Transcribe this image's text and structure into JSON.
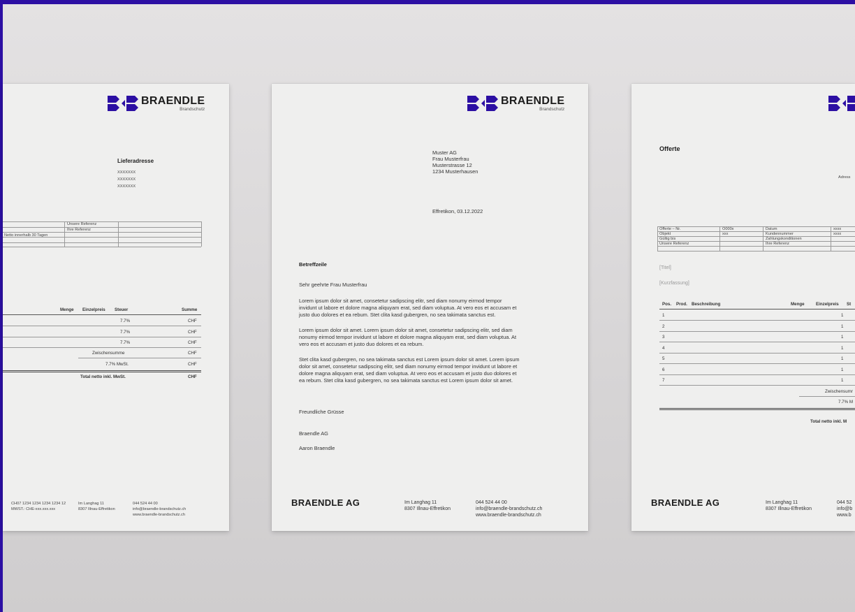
{
  "brand": {
    "name": "BRAENDLE",
    "sub": "Brandschutz",
    "footer_name": "BRAENDLE AG",
    "accent": "#2c0fa3"
  },
  "contact": {
    "address1": "Im Langhag 11",
    "address2": "8307 Illnau-Effretikon",
    "phone": "044 524 44 00",
    "email": "info@braendle-brandschutz.ch",
    "web": "www.braendle-brandschutz.ch"
  },
  "invoice": {
    "lieferadresse_title": "Lieferadresse",
    "address_lines": [
      "XXXXXXX",
      "XXXXXXX",
      "XXXXXXX"
    ],
    "ref_table": {
      "unsere_referenz": "Unsere Referenz",
      "ihre_referenz": "Ihre Referenz",
      "netto": "Netto innerhalb 30 Tagen"
    },
    "items_header": {
      "menge": "Menge",
      "einzelpreis": "Einzelpreis",
      "steuer": "Steuer",
      "summe": "Summe"
    },
    "rows": [
      {
        "steuer": "7.7%",
        "summe": "CHF"
      },
      {
        "steuer": "7.7%",
        "summe": "CHF"
      },
      {
        "steuer": "7.7%",
        "summe": "CHF"
      }
    ],
    "zwischensumme": "Zwischensumme",
    "zwischensumme_value": "CHF",
    "mwst": "7.7% MwSt.",
    "mwst_value": "CHF",
    "total": "Total netto inkl. MwSt.",
    "total_value": "CHF",
    "footer_iban": "CH07 1234 1234 1234 1234 12",
    "footer_mwst": "MWST.: CHE-xxx.xxx.xxx"
  },
  "letter": {
    "recipient": [
      "Muster AG",
      "Frau Musterfrau",
      "Musterstrasse 12",
      "1234 Musterhausen"
    ],
    "date": "Effretikon, 03.12.2022",
    "subject": "Betreffzeile",
    "salutation": "Sehr geehrte Frau Musterfrau",
    "paragraphs": [
      [
        "Lorem ipsum dolor sit amet, consetetur sadipscing elitr, sed diam nonumy eirmod tempor",
        "invidunt ut labore et dolore magna aliquyam erat, sed diam voluptua. At vero eos et accusam et",
        "justo duo dolores et ea rebum. Stet clita kasd gubergren, no sea takimata sanctus est."
      ],
      [
        "Lorem ipsum dolor sit amet. Lorem ipsum dolor sit amet, consetetur sadipscing elitr, sed diam",
        "nonumy eirmod tempor invidunt ut labore et dolore magna aliquyam erat, sed diam voluptua. At",
        "vero eos et accusam et justo duo dolores et ea rebum."
      ],
      [
        "Stet clita kasd gubergren, no sea takimata sanctus est Lorem ipsum dolor sit amet. Lorem ipsum",
        "dolor sit amet, consetetur sadipscing elitr, sed diam nonumy eirmod tempor invidunt ut labore et",
        "dolore magna aliquyam erat, sed diam voluptua. At vero eos et accusam et justo duo dolores et",
        "ea rebum. Stet clita kasd gubergren, no sea takimata sanctus est Lorem ipsum dolor sit amet."
      ]
    ],
    "closing": "Freundliche Grüsse",
    "company": "Braendle AG",
    "signer": "Aaron Braendle"
  },
  "offer": {
    "title": "Offerte",
    "adresse_label": "Adress",
    "fields_left": [
      {
        "label": "Offerte – Nr.",
        "value": "O000x"
      },
      {
        "label": "Objekt",
        "value": "xxx"
      },
      {
        "label": "Gültig bis",
        "value": ""
      },
      {
        "label": "Unsere Referenz",
        "value": ""
      }
    ],
    "fields_right": [
      {
        "label": "Datum",
        "value": "xxxx"
      },
      {
        "label": "Kundennummer",
        "value": "xxxx"
      },
      {
        "label": "Zahlungskonditionen",
        "value": ""
      },
      {
        "label": "Ihre Referenz",
        "value": ""
      }
    ],
    "titel_placeholder": "[Titel]",
    "kurz_placeholder": "[Kurzfassung]",
    "table_header": {
      "pos": "Pos.",
      "prod": "Prod.",
      "beschreibung": "Beschreibung",
      "menge": "Menge",
      "einzelpreis": "Einzelpreis",
      "st": "St"
    },
    "rows": [
      {
        "pos": "1",
        "menge": "1"
      },
      {
        "pos": "2",
        "menge": "1"
      },
      {
        "pos": "3",
        "menge": "1"
      },
      {
        "pos": "4",
        "menge": "1"
      },
      {
        "pos": "5",
        "menge": "1"
      },
      {
        "pos": "6",
        "menge": "1"
      },
      {
        "pos": "7",
        "menge": "1"
      }
    ],
    "zwischensumme": "Zwischensumr",
    "mwst": "7.7% M",
    "total": "Total netto inkl. M",
    "phone_partial": "044 52",
    "email_partial": "info@b",
    "web_partial": "www.b"
  }
}
